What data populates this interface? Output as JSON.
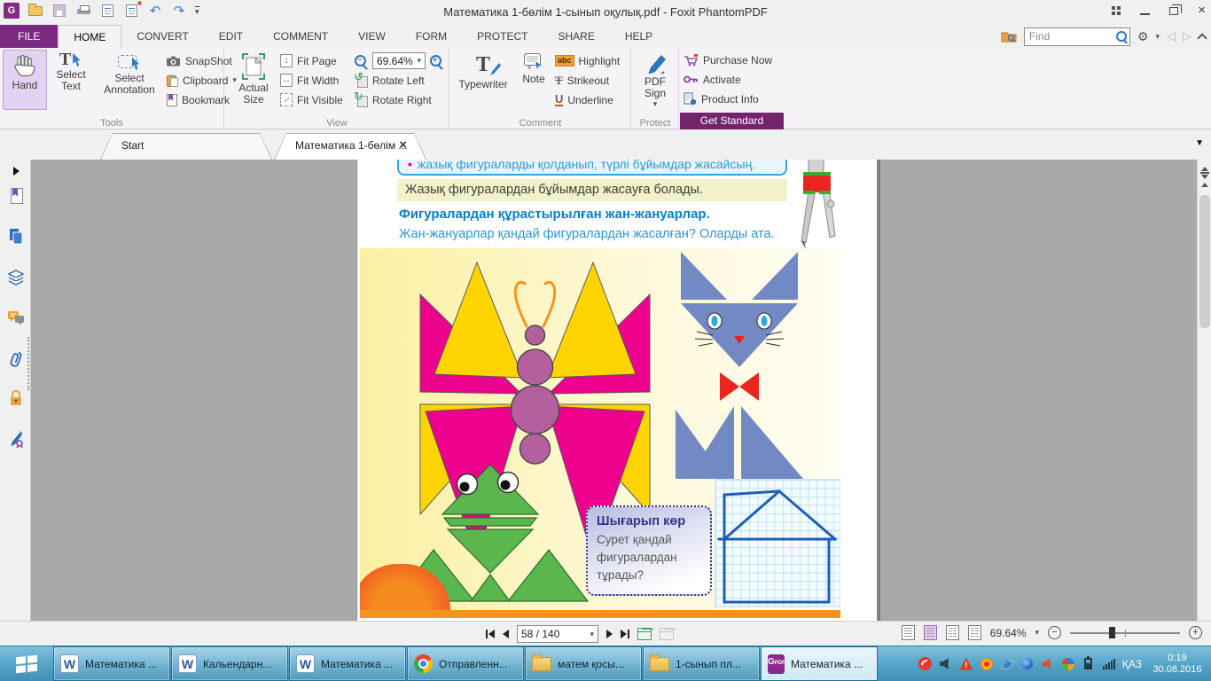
{
  "window": {
    "title": "Математика 1-бөлім 1-сынып оқулық.pdf - Foxit PhantomPDF"
  },
  "ribbon": {
    "tabs": [
      "FILE",
      "HOME",
      "CONVERT",
      "EDIT",
      "COMMENT",
      "VIEW",
      "FORM",
      "PROTECT",
      "SHARE",
      "HELP"
    ],
    "active_tab": "HOME",
    "find_placeholder": "Find",
    "tools": {
      "label": "Tools",
      "hand": "Hand",
      "select_text": "Select Text",
      "select_annotation": "Select Annotation",
      "snapshot": "SnapShot",
      "clipboard": "Clipboard",
      "bookmark": "Bookmark"
    },
    "view": {
      "label": "View",
      "actual_size": "Actual Size",
      "fit_page": "Fit Page",
      "fit_width": "Fit Width",
      "fit_visible": "Fit Visible",
      "zoom_value": "69.64%",
      "rotate_left": "Rotate Left",
      "rotate_right": "Rotate Right"
    },
    "comment": {
      "label": "Comment",
      "typewriter": "Typewriter",
      "note": "Note",
      "highlight": "Highlight",
      "strikeout": "Strikeout",
      "underline": "Underline"
    },
    "protect": {
      "label": "Protect",
      "pdf_sign": "PDF Sign"
    },
    "get_standard": {
      "label": "Get Standard",
      "purchase_now": "Purchase Now",
      "activate": "Activate",
      "product_info": "Product Info"
    }
  },
  "doc_tabs": {
    "start": "Start",
    "document": "Математика 1-бөлім ..."
  },
  "pdf_page": {
    "bullet": "•",
    "callout_top": "жазық фигураларды қолданып, түрлі бұйымдар жасайсың.",
    "highlight_line": "Жазық фигуралардан бұйымдар жасауға болады.",
    "heading": "Фигуралардан құрастырылған жан-жануарлар.",
    "question": "Жан-жануарлар қандай фигуралардан жасалған? Оларды ата.",
    "try_box": {
      "title": "Шығарып көр",
      "line1": "Сурет қандай",
      "line2": "фигуралардан",
      "line3": "тұрады?"
    },
    "figures": [
      "butterfly-of-shapes",
      "cat-of-triangles",
      "frog-of-triangles",
      "house-on-grid",
      "compass-mascot"
    ],
    "colors": {
      "magenta": "#ec008c",
      "yellow": "#ffd400",
      "body_purple": "#b4609f",
      "cat_blue": "#7289c4",
      "accent_red": "#e8251f",
      "frog_green": "#5bb64d",
      "house_blue": "#1d5fb8",
      "orange": "#f6921e"
    }
  },
  "status_bar": {
    "page_indicator": "58 / 140",
    "zoom_percent": "69.64%"
  },
  "taskbar": {
    "buttons": [
      {
        "app": "word",
        "label": "Математика ..."
      },
      {
        "app": "word",
        "label": "Кальендарн..."
      },
      {
        "app": "word",
        "label": "Математика ..."
      },
      {
        "app": "chrome",
        "label": "Отправленн..."
      },
      {
        "app": "folder",
        "label": "матем қосы..."
      },
      {
        "app": "folder",
        "label": "1-сынып пл..."
      },
      {
        "app": "foxit",
        "label": "Математика ...",
        "active": true
      }
    ],
    "tray": {
      "language": "ҚАЗ",
      "time": "0:19",
      "date": "30.08.2016"
    }
  },
  "glyphs": {
    "dropdown": "▾",
    "menu_down": "▼",
    "close": "×",
    "gear": "⚙",
    "chevron_prev": "◁",
    "chevron_next": "▷",
    "rotate_left": "↺",
    "rotate_right": "↻",
    "arrows_v": "↕",
    "arrows_h": "↔",
    "minus": "−",
    "plus": "+",
    "letter_t": "T",
    "letter_u": "U",
    "abc": "abc",
    "letter_w": "W",
    "letter_g": "G",
    "pdf": "PDF",
    "star": "*",
    "undo": "↶",
    "redo": "↷",
    "exclaim": "!"
  }
}
